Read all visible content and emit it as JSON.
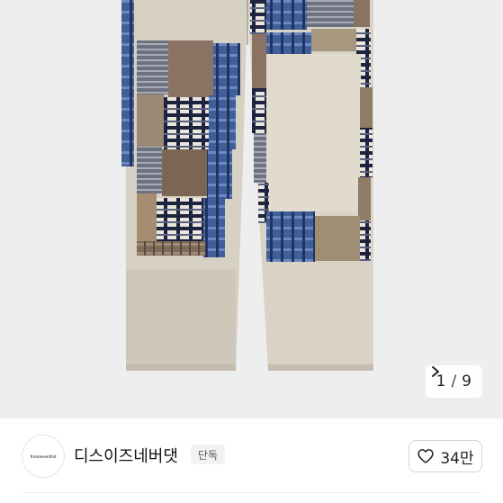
{
  "image_counter": {
    "current": "1",
    "separator": "/",
    "total": "9"
  },
  "seller": {
    "avatar_text": "thisisneverthat",
    "name": "디스이즈네버댓",
    "badge": "단독"
  },
  "like": {
    "count": "34만"
  },
  "icons": {
    "chevron": "chevron-right-icon",
    "heart": "heart-outline-icon"
  }
}
